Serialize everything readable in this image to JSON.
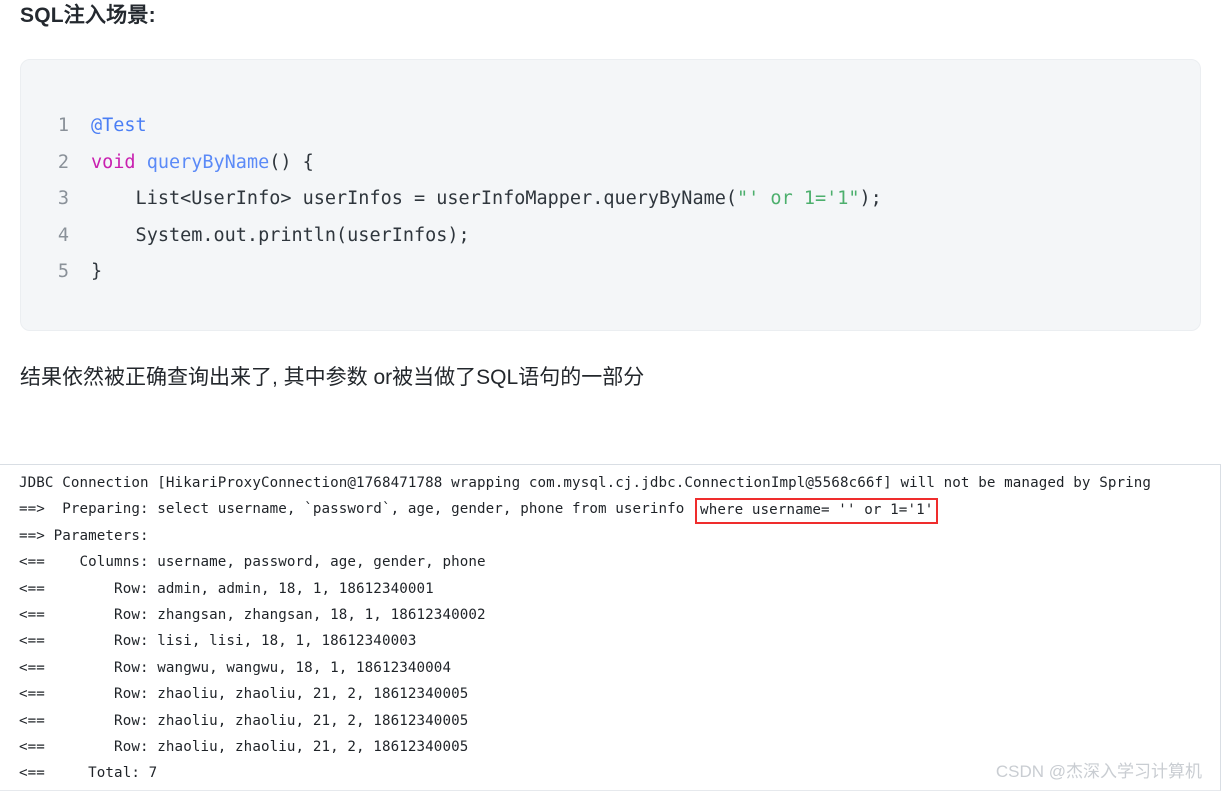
{
  "page_title": "SQL注入场景:",
  "code_block": {
    "language": "java",
    "lines": [
      {
        "number": "1",
        "tokens": [
          {
            "t": "",
            "text": ""
          },
          {
            "t": "anno",
            "text": "@Test"
          }
        ]
      },
      {
        "number": "2",
        "tokens": [
          {
            "t": "key",
            "text": "void"
          },
          {
            "t": "plain",
            "text": " "
          },
          {
            "t": "fn",
            "text": "queryByName"
          },
          {
            "t": "plain",
            "text": "() {"
          }
        ]
      },
      {
        "number": "3",
        "tokens": [
          {
            "t": "plain",
            "text": "    List<UserInfo> userInfos = userInfoMapper.queryByName("
          },
          {
            "t": "str",
            "text": "\"' or 1='1\""
          },
          {
            "t": "plain",
            "text": ");"
          }
        ]
      },
      {
        "number": "4",
        "tokens": [
          {
            "t": "plain",
            "text": "    System.out.println(userInfos);"
          }
        ]
      },
      {
        "number": "5",
        "tokens": [
          {
            "t": "plain",
            "text": "}"
          }
        ]
      }
    ]
  },
  "paragraph": "结果依然被正确查询出来了, 其中参数 or被当做了SQL语句的一部分",
  "console": {
    "lines": [
      {
        "text": "JDBC Connection [HikariProxyConnection@1768471788 wrapping com.mysql.cj.jdbc.ConnectionImpl@5568c66f] will not be managed by Spring",
        "highlight": null
      },
      {
        "text": "==>  Preparing: select username, `password`, age, gender, phone from userinfo ",
        "highlight": "where username= '' or 1='1'"
      },
      {
        "text": "==> Parameters:",
        "highlight": null
      },
      {
        "text": "<==    Columns: username, password, age, gender, phone",
        "highlight": null
      },
      {
        "text": "<==        Row: admin, admin, 18, 1, 18612340001",
        "highlight": null
      },
      {
        "text": "<==        Row: zhangsan, zhangsan, 18, 1, 18612340002",
        "highlight": null
      },
      {
        "text": "<==        Row: lisi, lisi, 18, 1, 18612340003",
        "highlight": null
      },
      {
        "text": "<==        Row: wangwu, wangwu, 18, 1, 18612340004",
        "highlight": null
      },
      {
        "text": "<==        Row: zhaoliu, zhaoliu, 21, 2, 18612340005",
        "highlight": null
      },
      {
        "text": "<==        Row: zhaoliu, zhaoliu, 21, 2, 18612340005",
        "highlight": null
      },
      {
        "text": "<==        Row: zhaoliu, zhaoliu, 21, 2, 18612340005",
        "highlight": null
      },
      {
        "text": "<==     Total: 7",
        "highlight": null
      }
    ],
    "highlight_color": "#ef2d2d"
  },
  "watermark": "CSDN @杰深入学习计算机"
}
